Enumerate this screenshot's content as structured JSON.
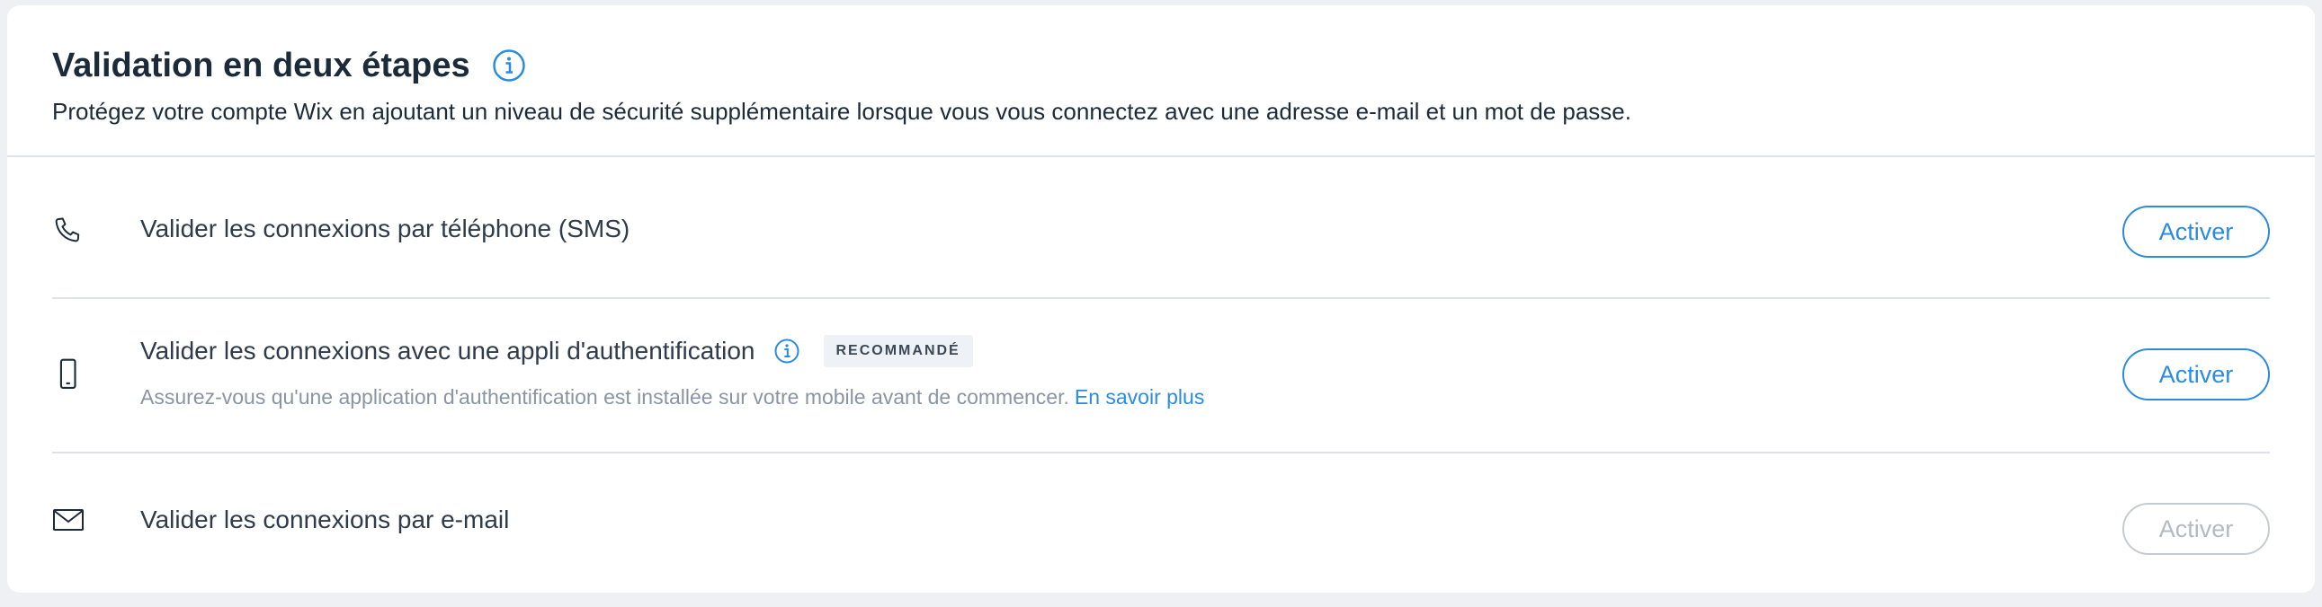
{
  "header": {
    "title": "Validation en deux étapes",
    "subtitle": "Protégez votre compte Wix en ajoutant un niveau de sécurité supplémentaire lorsque vous vous connectez avec une adresse e-mail et un mot de passe.",
    "info_icon": "info-icon"
  },
  "methods": [
    {
      "icon": "phone-icon",
      "label": "Valider les connexions par téléphone (SMS)",
      "button": "Activer",
      "button_enabled": true
    },
    {
      "icon": "mobile-device-icon",
      "label": "Valider les connexions avec une appli d'authentification",
      "info_icon": "info-icon",
      "badge": "RECOMMANDÉ",
      "description": "Assurez-vous qu'une application d'authentification est installée sur votre mobile avant de commencer.",
      "link": "En savoir plus",
      "button": "Activer",
      "button_enabled": true
    },
    {
      "icon": "envelope-icon",
      "label": "Valider les connexions par e-mail",
      "button": "Activer",
      "button_enabled": false
    }
  ],
  "colors": {
    "accent": "#2a8be0",
    "text": "#1c2b39",
    "muted": "#8a95a3",
    "disabled": "#b4bac2"
  }
}
